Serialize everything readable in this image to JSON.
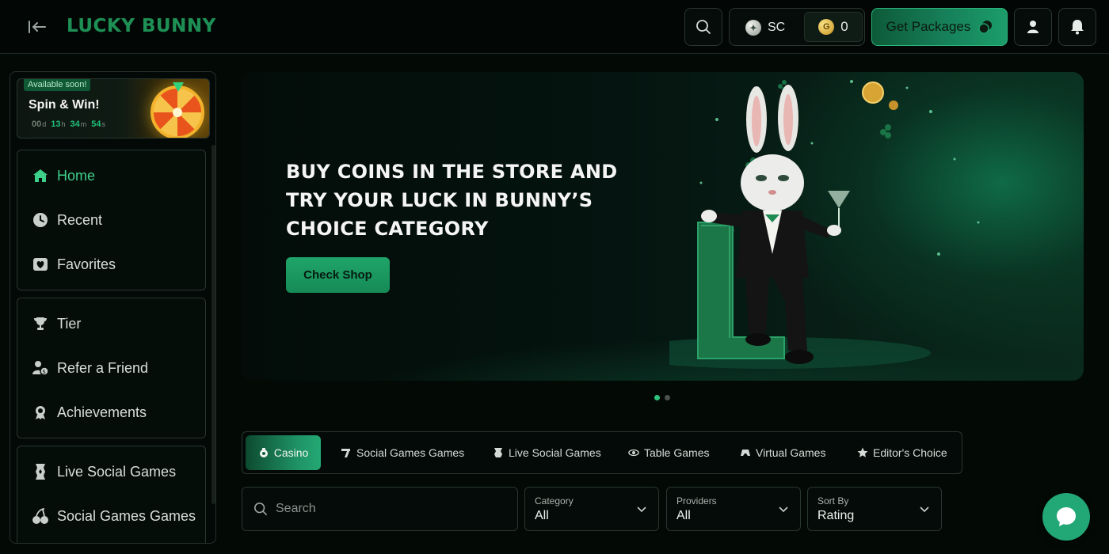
{
  "header": {
    "logo": "LUCKY BUNNY",
    "currency": {
      "sc_label": "SC",
      "gc_value": "0"
    },
    "get_packages_label": "Get Packages"
  },
  "sidebar": {
    "promo": {
      "badge": "Available soon!",
      "title": "Spin & Win!",
      "timer": {
        "days": "00",
        "hours": "13",
        "minutes": "34",
        "seconds": "54"
      },
      "units": {
        "d": "d",
        "h": "h",
        "m": "m",
        "s": "s"
      }
    },
    "groups": [
      {
        "items": [
          {
            "label": "Home",
            "icon": "home-icon",
            "active": true
          },
          {
            "label": "Recent",
            "icon": "clock-icon"
          },
          {
            "label": "Favorites",
            "icon": "heart-icon"
          }
        ]
      },
      {
        "items": [
          {
            "label": "Tier",
            "icon": "trophy-icon"
          },
          {
            "label": "Refer a Friend",
            "icon": "refer-icon"
          },
          {
            "label": "Achievements",
            "icon": "medal-icon"
          }
        ]
      },
      {
        "items": [
          {
            "label": "Live Social Games",
            "icon": "live-games-icon"
          },
          {
            "label": "Social Games Games",
            "icon": "cherries-icon"
          }
        ]
      }
    ]
  },
  "hero": {
    "title": "BUY COINS IN THE STORE AND TRY YOUR LUCK IN BUNNY’S CHOICE CATEGORY",
    "cta_label": "Check Shop",
    "slide_count": 2,
    "active_slide": 1
  },
  "tabs": [
    {
      "label": "Casino",
      "icon": "casino-icon",
      "active": true
    },
    {
      "label": "Social Games Games",
      "icon": "slot-icon"
    },
    {
      "label": "Live Social Games",
      "icon": "live-icon"
    },
    {
      "label": "Table Games",
      "icon": "table-icon"
    },
    {
      "label": "Virtual Games",
      "icon": "virtual-icon"
    },
    {
      "label": "Editor's Choice",
      "icon": "star-icon"
    }
  ],
  "filters": {
    "search_placeholder": "Search",
    "category": {
      "label": "Category",
      "value": "All"
    },
    "providers": {
      "label": "Providers",
      "value": "All"
    },
    "sort": {
      "label": "Sort By",
      "value": "Rating"
    }
  },
  "colors": {
    "accent": "#1fa56a",
    "logo": "#1e8f55",
    "background": "#030a06"
  }
}
